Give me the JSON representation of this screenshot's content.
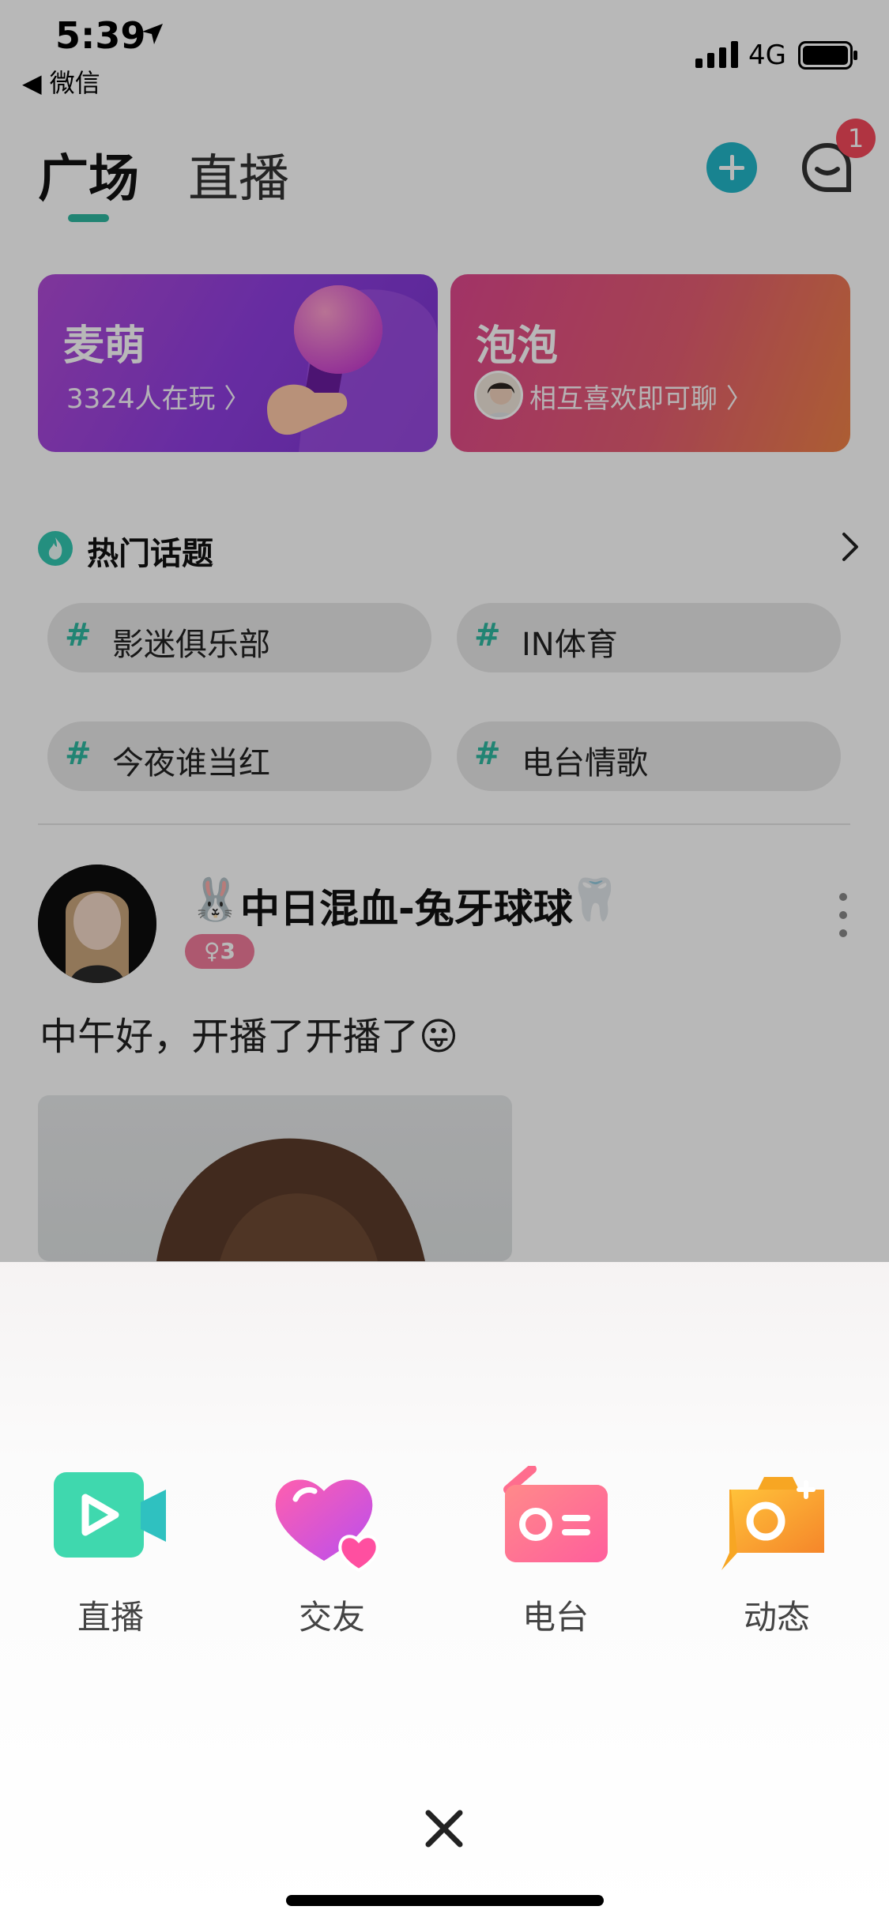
{
  "status_bar": {
    "time": "5:39",
    "back_app": "◀ 微信",
    "network": "4G"
  },
  "nav": {
    "tabs": [
      "广场",
      "直播"
    ],
    "active_tab": "广场",
    "message_badge": "1"
  },
  "cards": [
    {
      "title": "麦萌",
      "subtitle": "3324人在玩 〉"
    },
    {
      "title": "泡泡",
      "subtitle": "相互喜欢即可聊 〉"
    }
  ],
  "hot_topics": {
    "title": "热门话题",
    "items": [
      "影迷俱乐部",
      "IN体育",
      "今夜谁当红",
      "电台情歌"
    ],
    "hash": "#"
  },
  "post": {
    "name_prefix_emoji": "🐰",
    "username": "中日混血-兔牙球球",
    "name_suffix_emoji": "🦷",
    "level": "♀3",
    "text": "中午好，开播了开播了😛"
  },
  "sheet": {
    "actions": [
      {
        "label": "直播",
        "icon": "video-camera-icon"
      },
      {
        "label": "交友",
        "icon": "hearts-icon"
      },
      {
        "label": "电台",
        "icon": "radio-icon"
      },
      {
        "label": "动态",
        "icon": "camera-plus-icon"
      }
    ]
  },
  "colors": {
    "accent": "#2fb8a0",
    "badge": "#f4485b",
    "card_purple": "#8f3ee0",
    "card_pink": "#e55d72"
  }
}
